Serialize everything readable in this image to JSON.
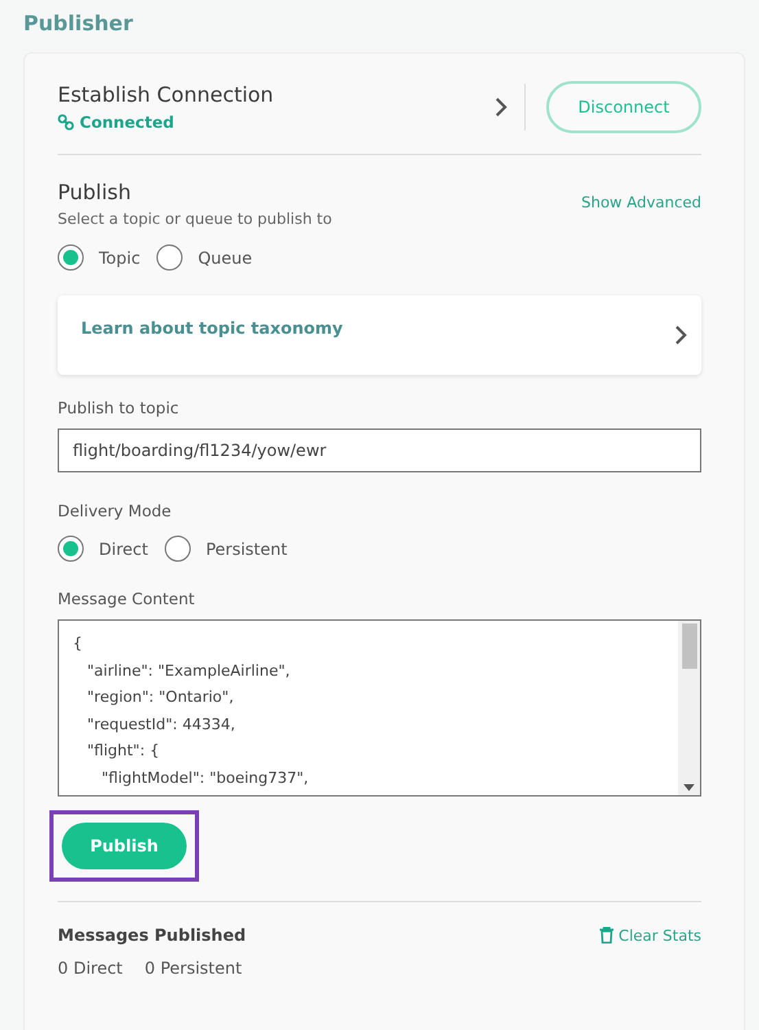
{
  "page_title": "Publisher",
  "connection": {
    "title": "Establish Connection",
    "status": "Connected",
    "connected": true,
    "button": "Disconnect"
  },
  "publish": {
    "title": "Publish",
    "subtitle": "Select a topic or queue to publish to",
    "advanced_link": "Show Advanced",
    "destination": [
      {
        "label": "Topic",
        "selected": true
      },
      {
        "label": "Queue",
        "selected": false
      }
    ],
    "learn_card": "Learn about topic taxonomy",
    "topic_label": "Publish to topic",
    "topic_value": "flight/boarding/fl1234/yow/ewr",
    "delivery_label": "Delivery Mode",
    "delivery": [
      {
        "label": "Direct",
        "selected": true
      },
      {
        "label": "Persistent",
        "selected": false
      }
    ],
    "content_label": "Message Content",
    "content_lines": [
      "{",
      "   \"airline\": \"ExampleAirline\",",
      "   \"region\": \"Ontario\",",
      "   \"requestId\": 44334,",
      "   \"flight\": {",
      "      \"flightModel\": \"boeing737\","
    ],
    "button": {
      "label": "Publish",
      "focused": true
    }
  },
  "stats": {
    "title": "Messages Published",
    "clear": "Clear Stats",
    "counts": [
      "0 Direct",
      "0 Persistent"
    ]
  }
}
